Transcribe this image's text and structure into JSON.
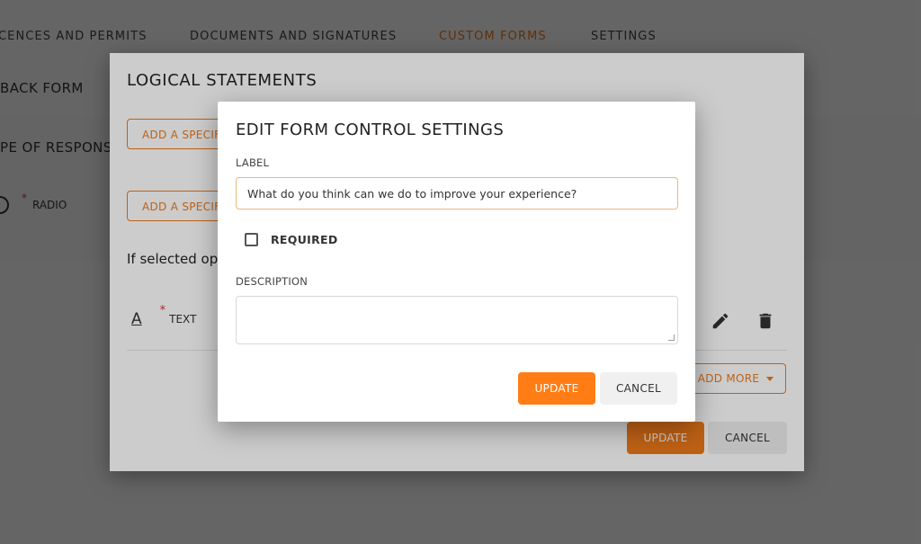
{
  "tabs": {
    "licences": "CENCES AND PERMITS",
    "documents": "DOCUMENTS AND SIGNATURES",
    "custom_forms": "CUSTOM FORMS",
    "settings": "SETTINGS"
  },
  "background": {
    "form_title": "BACK FORM",
    "response_type_label": "PE OF RESPONSE",
    "radio_label": "RADIO",
    "required_mark": "*"
  },
  "logical_dialog": {
    "title": "LOGICAL STATEMENTS",
    "add_specific_1": "ADD A SPECIFIC",
    "add_specific_2": "ADD A SPECIFIC",
    "if_selected": "If selected op",
    "text_item_icon": "A",
    "text_item_required": "*",
    "text_item_label": "TEXT",
    "add_more": "ADD MORE",
    "update": "UPDATE",
    "cancel": "CANCEL"
  },
  "edit_dialog": {
    "title": "EDIT FORM CONTROL SETTINGS",
    "label_field_label": "LABEL",
    "label_value": "What do you think can we do to improve your experience?",
    "required_label": "REQUIRED",
    "required_checked": false,
    "description_label": "DESCRIPTION",
    "description_value": "",
    "update": "UPDATE",
    "cancel": "CANCEL"
  },
  "icons": {
    "edit": "pencil-icon",
    "delete": "trash-icon",
    "text": "text-format-icon",
    "dropdown": "caret-down-icon"
  },
  "colors": {
    "accent": "#ee7a1b",
    "primary_button": "#ff7d14",
    "required": "#dd3333"
  }
}
